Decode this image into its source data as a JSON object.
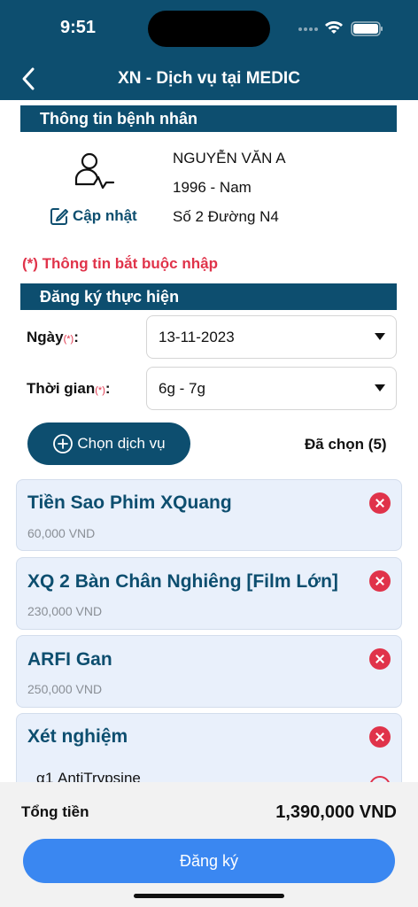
{
  "status_bar": {
    "time": "9:51"
  },
  "nav": {
    "title": "XN - Dịch vụ tại MEDIC",
    "back_icon": "chevron-left-icon"
  },
  "patient_section": {
    "heading": "Thông tin bệnh nhân",
    "name": "NGUYỄN VĂN A",
    "birth_gender": "1996 - Nam",
    "address": "Số 2 Đường N4",
    "update_label": "Cập nhật"
  },
  "required_note": "(*) Thông tin bắt buộc nhập",
  "register_section": {
    "heading": "Đăng ký thực hiện",
    "date_label": "Ngày",
    "date_value": "13-11-2023",
    "time_label": "Thời gian",
    "time_value": "6g - 7g",
    "required_mark": "(*)",
    "colon": ":"
  },
  "services": {
    "choose_label": "Chọn dịch vụ",
    "selected_count": "Đã chọn (5)",
    "items": [
      {
        "name": "Tiền Sao Phim XQuang",
        "price": "60,000 VND"
      },
      {
        "name": "XQ 2 Bàn Chân Nghiêng [Film Lớn]",
        "price": "230,000 VND"
      },
      {
        "name": "ARFI Gan",
        "price": "250,000 VND"
      },
      {
        "name": "Xét nghiệm",
        "sub_items": [
          "α1 AntiTrypsine"
        ]
      }
    ]
  },
  "footer": {
    "total_label": "Tổng tiền",
    "total_value": "1,390,000 VND",
    "submit_label": "Đăng ký"
  },
  "colors": {
    "primary": "#0d4e6f",
    "accent": "#3a87f1",
    "required": "#e0334a",
    "card_bg": "#e9f0fb"
  }
}
